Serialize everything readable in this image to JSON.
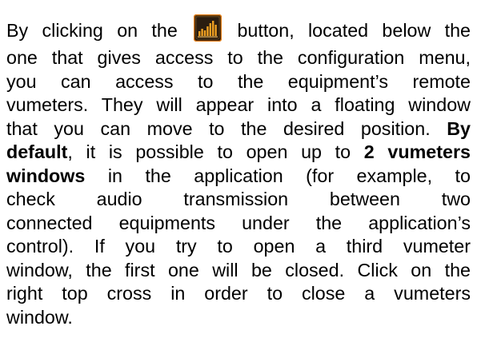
{
  "paragraph": {
    "line1_pre": "By clicking on the",
    "line1_post": "button, located below the",
    "line2": "one that gives access to the configuration menu,",
    "line3": "you can access to the equipment’s remote",
    "line4": "vumeters. They will appear into a floating window",
    "line5_pre": "that you can move to the desired position.",
    "line5_bold": "By",
    "line6_bold1": "default",
    "line6_mid": ", it is possible to open up to",
    "line6_bold2": "2 vumeters",
    "line7_bold": "windows",
    "line7_post": "in the application (for example, to",
    "line8": "check audio transmission between two",
    "line9": "connected equipments under the application’s",
    "line10": "control). If you try to open a third vumeter",
    "line11": "window, the first one will be closed. Click on the",
    "line12": "right top cross in order to close a vumeters",
    "line13": "window."
  },
  "icon": {
    "name": "vumeter-button-icon",
    "bg_color": "#2a1d10",
    "bar_color": "#f0a021",
    "border_color": "#e07a10"
  }
}
